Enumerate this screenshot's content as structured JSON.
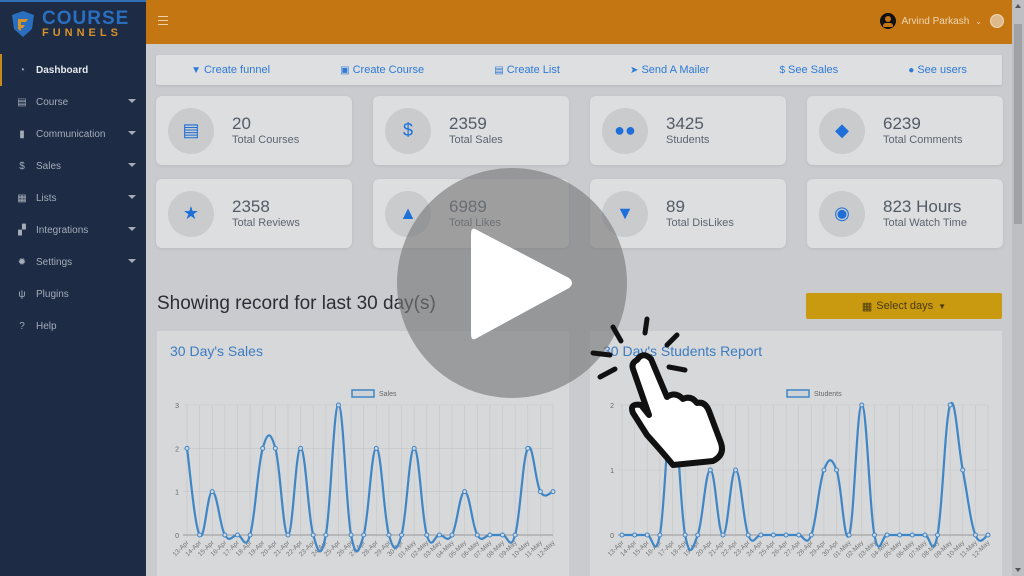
{
  "brand": {
    "line1": "COURSE",
    "line2": "FUNNELS"
  },
  "sidebar": {
    "items": [
      {
        "label": "Dashboard",
        "icon": "dashboard-icon",
        "active": true,
        "has_caret": false
      },
      {
        "label": "Course",
        "icon": "book-icon",
        "has_caret": true
      },
      {
        "label": "Communication",
        "icon": "comment-icon",
        "has_caret": true
      },
      {
        "label": "Sales",
        "icon": "hand-dollar-icon",
        "has_caret": true
      },
      {
        "label": "Lists",
        "icon": "clipboard-icon",
        "has_caret": true
      },
      {
        "label": "Integrations",
        "icon": "puzzle-icon",
        "has_caret": true
      },
      {
        "label": "Settings",
        "icon": "gear-icon",
        "has_caret": true
      },
      {
        "label": "Plugins",
        "icon": "plug-icon",
        "has_caret": false
      },
      {
        "label": "Help",
        "icon": "help-icon",
        "has_caret": false
      }
    ]
  },
  "header": {
    "user_name": "Arvind Parkash"
  },
  "quick_links": [
    {
      "label": "Create funnel",
      "icon": "funnel-icon"
    },
    {
      "label": "Create Course",
      "icon": "book-icon"
    },
    {
      "label": "Create List",
      "icon": "clipboard-icon"
    },
    {
      "label": "Send A Mailer",
      "icon": "paper-plane-icon"
    },
    {
      "label": "See Sales",
      "icon": "hand-dollar-icon"
    },
    {
      "label": "See users",
      "icon": "users-icon"
    }
  ],
  "stats": [
    {
      "value": "20",
      "label": "Total Courses",
      "icon": "book-icon"
    },
    {
      "value": "2359",
      "label": "Total Sales",
      "icon": "hand-dollar-icon"
    },
    {
      "value": "3425",
      "label": "Students",
      "icon": "users-icon"
    },
    {
      "value": "6239",
      "label": "Total Comments",
      "icon": "comments-icon"
    },
    {
      "value": "2358",
      "label": "Total Reviews",
      "icon": "star-icon"
    },
    {
      "value": "6989",
      "label": "Total Likes",
      "icon": "thumbs-up-icon"
    },
    {
      "value": "89",
      "label": "Total DisLikes",
      "icon": "thumbs-down-icon"
    },
    {
      "value": "823 Hours",
      "label": "Total Watch Time",
      "icon": "eye-icon"
    }
  ],
  "section": {
    "heading": "Showing record for last 30 day(s)",
    "select_days_label": "Select days"
  },
  "colors": {
    "header": "#c37612",
    "sidebar": "#1d2b45",
    "accent_blue": "#1e6fd8",
    "select_button": "#c9990f",
    "line": "#3f86c6"
  },
  "chart_data": [
    {
      "type": "line",
      "title": "30 Day's Sales",
      "legend": [
        "Sales"
      ],
      "legend_position": "top",
      "categories": [
        "13-Apr",
        "14-Apr",
        "15-Apr",
        "16-Apr",
        "17-Apr",
        "18-Apr",
        "19-Apr",
        "20-Apr",
        "21-Apr",
        "22-Apr",
        "23-Apr",
        "24-Apr",
        "25-Apr",
        "26-Apr",
        "27-Apr",
        "28-Apr",
        "29-Apr",
        "30-Apr",
        "01-May",
        "02-May",
        "03-May",
        "04-May",
        "05-May",
        "06-May",
        "07-May",
        "08-May",
        "09-May",
        "10-May",
        "11-May",
        "12-May"
      ],
      "series": [
        {
          "name": "Sales",
          "values": [
            2,
            0,
            1,
            0,
            0,
            0,
            2,
            2,
            0,
            2,
            0,
            0,
            3,
            0,
            0,
            2,
            0,
            0,
            2,
            0,
            0,
            0,
            1,
            0,
            0,
            0,
            0,
            2,
            1,
            1
          ]
        }
      ],
      "ylim": [
        0,
        3
      ],
      "yticks": [
        0,
        1,
        2,
        3
      ],
      "grid": true
    },
    {
      "type": "line",
      "title": "30 Day's Students Report",
      "legend": [
        "Students"
      ],
      "legend_position": "top",
      "categories": [
        "13-Apr",
        "14-Apr",
        "15-Apr",
        "16-Apr",
        "17-Apr",
        "18-Apr",
        "19-Apr",
        "20-Apr",
        "21-Apr",
        "22-Apr",
        "23-Apr",
        "24-Apr",
        "25-Apr",
        "26-Apr",
        "27-Apr",
        "28-Apr",
        "29-Apr",
        "30-Apr",
        "01-May",
        "02-May",
        "03-May",
        "04-May",
        "05-May",
        "06-May",
        "07-May",
        "08-May",
        "09-May",
        "10-May",
        "11-May",
        "12-May"
      ],
      "series": [
        {
          "name": "Students",
          "values": [
            0,
            0,
            0,
            0,
            2,
            0,
            0,
            1,
            0,
            1,
            0,
            0,
            0,
            0,
            0,
            0,
            1,
            1,
            0,
            2,
            0,
            0,
            0,
            0,
            0,
            0,
            2,
            1,
            0,
            0
          ]
        }
      ],
      "ylim": [
        0,
        2
      ],
      "yticks": [
        0,
        1,
        2
      ],
      "grid": true
    }
  ]
}
